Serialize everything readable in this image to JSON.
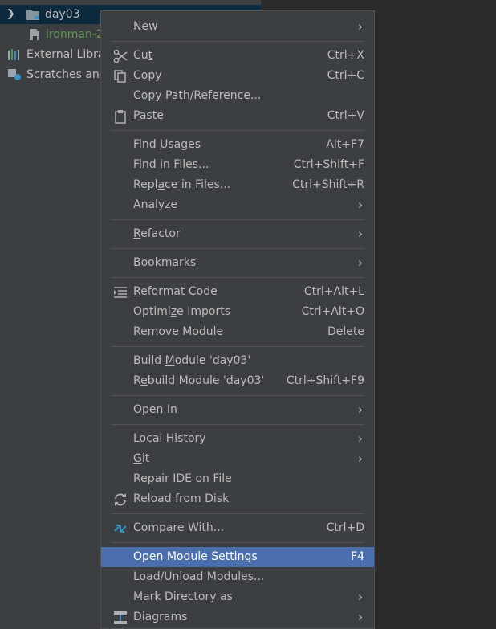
{
  "tree": {
    "day03": "day03",
    "ironman": "ironman-2",
    "external": "External Libra",
    "scratches": "Scratches and"
  },
  "menu": {
    "new": {
      "label": "New",
      "mnemonic_index": 0
    },
    "cut": {
      "label": "Cut",
      "shortcut": "Ctrl+X",
      "mnemonic_index": 2
    },
    "copy": {
      "label": "Copy",
      "shortcut": "Ctrl+C",
      "mnemonic_index": 0
    },
    "copy_path": {
      "label": "Copy Path/Reference...",
      "shortcut": ""
    },
    "paste": {
      "label": "Paste",
      "shortcut": "Ctrl+V",
      "mnemonic_index": 0
    },
    "find_usages": {
      "label": "Find Usages",
      "shortcut": "Alt+F7",
      "mnemonic_index": 5
    },
    "find_in_files": {
      "label": "Find in Files...",
      "shortcut": "Ctrl+Shift+F"
    },
    "replace_in_files": {
      "label": "Replace in Files...",
      "shortcut": "Ctrl+Shift+R",
      "mnemonic_index": 4
    },
    "analyze": {
      "label": "Analyze"
    },
    "refactor": {
      "label": "Refactor",
      "mnemonic_index": 0
    },
    "bookmarks": {
      "label": "Bookmarks"
    },
    "reformat": {
      "label": "Reformat Code",
      "shortcut": "Ctrl+Alt+L",
      "mnemonic_index": 0
    },
    "optimize": {
      "label": "Optimize Imports",
      "shortcut": "Ctrl+Alt+O",
      "mnemonic_index": 6
    },
    "remove_module": {
      "label": "Remove Module",
      "shortcut": "Delete"
    },
    "build_module": {
      "label": "Build Module 'day03'",
      "shortcut": "",
      "mnemonic_index": 6
    },
    "rebuild_module": {
      "label": "Rebuild Module 'day03'",
      "shortcut": "Ctrl+Shift+F9",
      "mnemonic_index": 1
    },
    "open_in": {
      "label": "Open In"
    },
    "local_history": {
      "label": "Local History",
      "mnemonic_index": 6
    },
    "git": {
      "label": "Git",
      "mnemonic_index": 0
    },
    "repair_ide": {
      "label": "Repair IDE on File"
    },
    "reload": {
      "label": "Reload from Disk"
    },
    "compare": {
      "label": "Compare With...",
      "shortcut": "Ctrl+D"
    },
    "open_module_settings": {
      "label": "Open Module Settings",
      "shortcut": "F4"
    },
    "load_unload": {
      "label": "Load/Unload Modules..."
    },
    "mark_directory": {
      "label": "Mark Directory as"
    },
    "diagrams": {
      "label": "Diagrams"
    }
  },
  "submenu_arrow": "›"
}
